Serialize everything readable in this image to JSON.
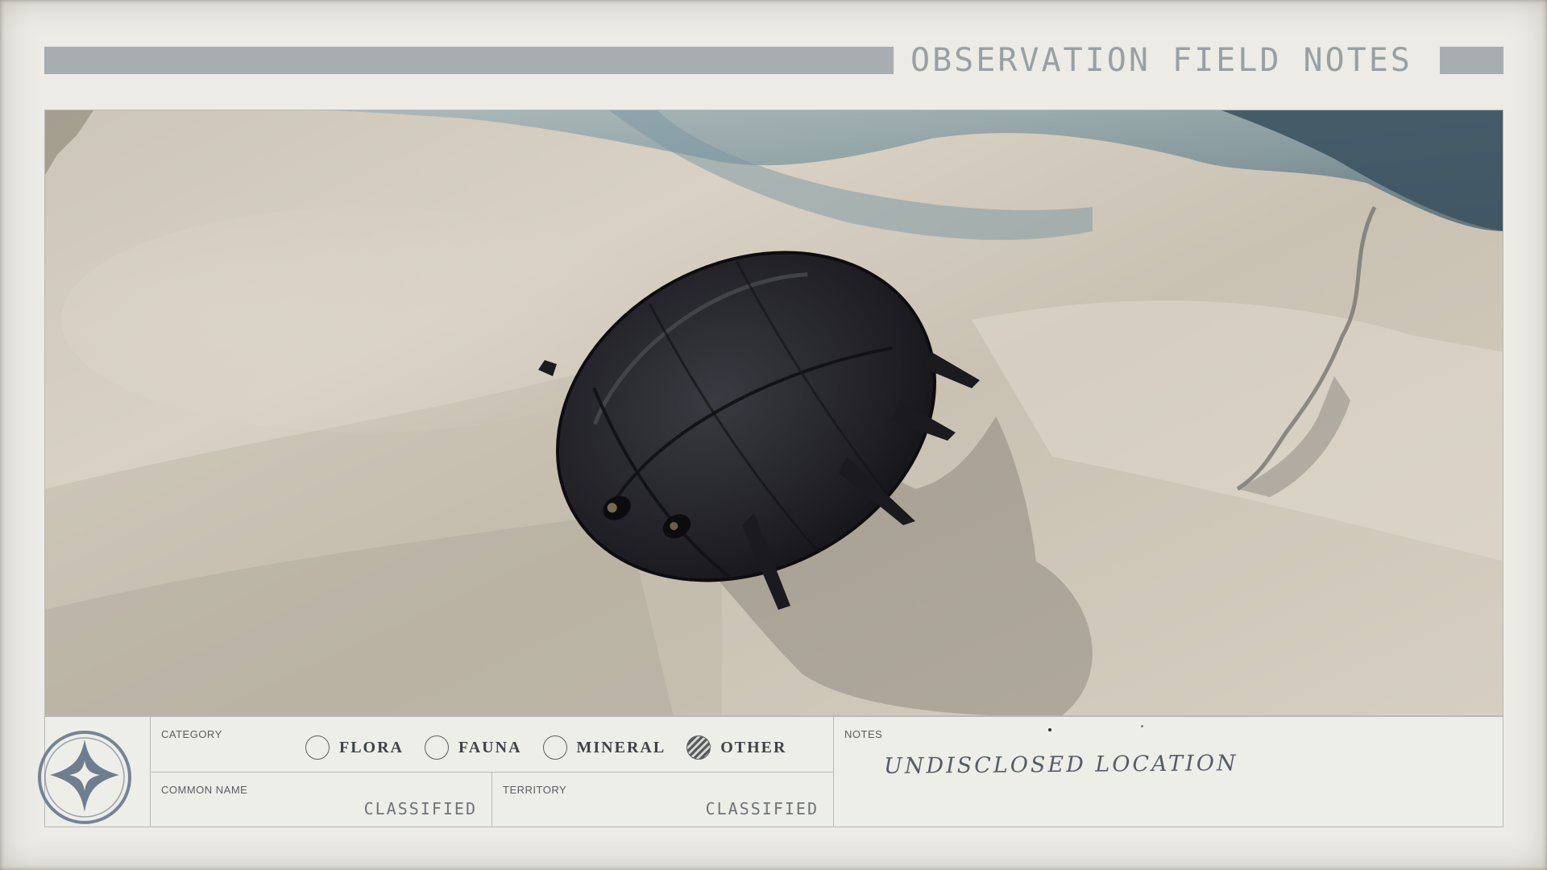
{
  "header": {
    "title": "OBSERVATION FIELD NOTES"
  },
  "photo": {
    "subject": "dark-shelled-creature-on-snow"
  },
  "category": {
    "label": "CATEGORY",
    "options": [
      {
        "label": "FLORA",
        "selected": false
      },
      {
        "label": "FAUNA",
        "selected": false
      },
      {
        "label": "MINERAL",
        "selected": false
      },
      {
        "label": "OTHER",
        "selected": true
      }
    ]
  },
  "common_name": {
    "label": "COMMON NAME",
    "value": "CLASSIFIED"
  },
  "territory": {
    "label": "TERRITORY",
    "value": "CLASSIFIED"
  },
  "notes": {
    "label": "NOTES",
    "value": "UNDISCLOSED LOCATION"
  },
  "colors": {
    "header_bar": "#a7adb0",
    "ink": "#3e4247",
    "snow": "#d6cfc1",
    "shell": "#25252b"
  },
  "icons": {
    "seal": "star-seal-icon"
  }
}
